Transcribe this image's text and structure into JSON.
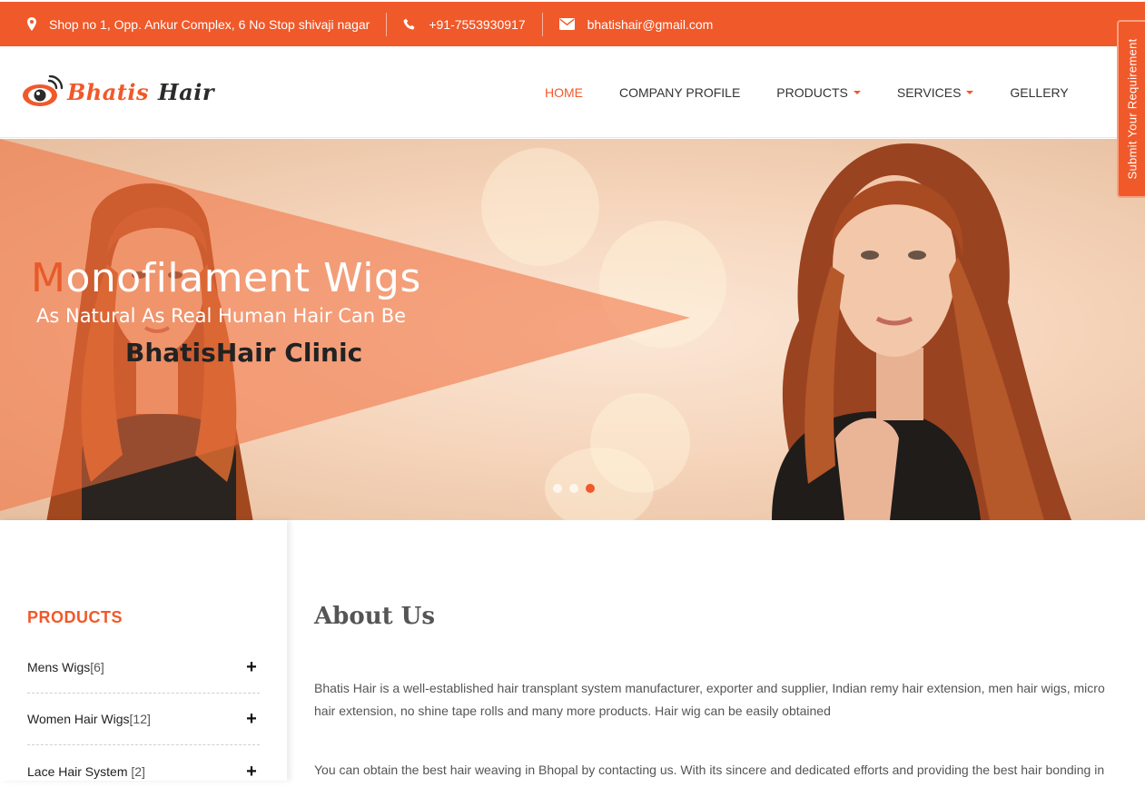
{
  "colors": {
    "accent": "#f0592a",
    "text": "#333333"
  },
  "topbar": {
    "address": "Shop no 1, Opp. Ankur Complex, 6 No Stop shivaji nagar",
    "phone": "+91-7553930917",
    "email": "bhatishair@gmail.com"
  },
  "logo": {
    "part1": "Bhatis",
    "part2": "Hair"
  },
  "nav": {
    "items": [
      {
        "label": "HOME"
      },
      {
        "label": "COMPANY PROFILE"
      },
      {
        "label": "PRODUCTS"
      },
      {
        "label": "SERVICES"
      },
      {
        "label": "GELLERY"
      }
    ]
  },
  "side_tab": {
    "label": "Submit Your Requirement"
  },
  "hero": {
    "title_first": "M",
    "title_rest": "onofilament Wigs",
    "subtitle": "As Natural As Real Human Hair Can Be",
    "brand": "BhatisHair Clinic",
    "slides": 3,
    "active_slide": 3
  },
  "sidebar": {
    "title": "PRODUCTS",
    "items": [
      {
        "label": "Mens Wigs",
        "count": "[6]"
      },
      {
        "label": "Women Hair Wigs",
        "count": "[12]"
      },
      {
        "label": "Lace Hair System ",
        "count": "[2]"
      }
    ]
  },
  "main": {
    "title": "About Us",
    "para1": "Bhatis Hair is a well-established hair transplant system manufacturer, exporter and supplier, Indian remy hair extension, men hair wigs, micro hair extension, no shine tape rolls and many more products. Hair wig can be easily obtained",
    "para2": "You can obtain the best hair weaving in Bhopal by contacting us. With its sincere and dedicated efforts and providing the best hair bonding in"
  }
}
